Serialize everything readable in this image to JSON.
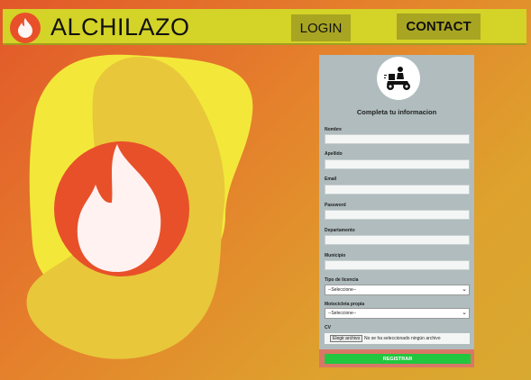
{
  "navbar": {
    "brand": "ALCHILAZO",
    "login_label": "LOGIN",
    "contact_label": "CONTACT"
  },
  "form": {
    "title": "Completa tu informacion",
    "fields": [
      {
        "label": "Nombre",
        "value": ""
      },
      {
        "label": "Apellido",
        "value": ""
      },
      {
        "label": "Email",
        "value": ""
      },
      {
        "label": "Password",
        "value": ""
      },
      {
        "label": "Departamento",
        "value": ""
      },
      {
        "label": "Municipio",
        "value": ""
      }
    ],
    "license_label": "Tipo de licencia",
    "license_selected": "--Seleccione--",
    "motorcycle_label": "Motocicleta propia",
    "motorcycle_selected": "--Seleccione--",
    "cv_label": "CV",
    "file_button": "Elegir archivo",
    "file_status": "No se ha seleccionado ningún archivo",
    "submit_label": "REGISTRAR"
  },
  "icons": {
    "logo": "fire-icon",
    "hero": "fire-icon",
    "form_avatar": "motorcycle-delivery-icon",
    "select_arrow": "chevron-down-icon"
  },
  "colors": {
    "navbar": "#d4d327",
    "nav_button": "#a8a522",
    "fire_circle": "#e8502a",
    "form_bg": "#b0bcbe",
    "submit": "#22c63f",
    "blob_back": "#f3e83a",
    "blob_front": "#e8c73a"
  }
}
